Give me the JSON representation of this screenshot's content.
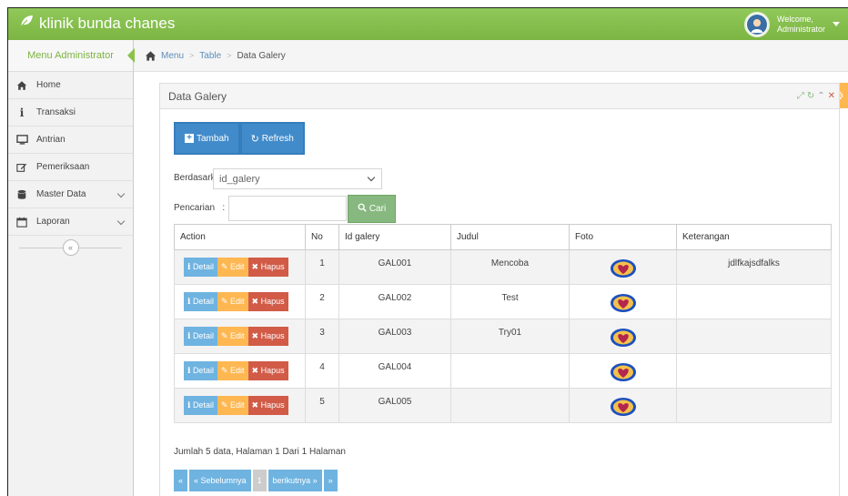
{
  "navbar": {
    "brand": "klinik bunda chanes",
    "welcome": "Welcome,",
    "user": "Administrator"
  },
  "sidebar": {
    "title": "Menu Administrator",
    "items": [
      {
        "label": "Home",
        "icon": "home-icon"
      },
      {
        "label": "Transaksi",
        "icon": "info-icon"
      },
      {
        "label": "Antrian",
        "icon": "desktop-icon"
      },
      {
        "label": "Pemeriksaan",
        "icon": "edit-icon"
      },
      {
        "label": "Master Data",
        "icon": "database-icon"
      },
      {
        "label": "Laporan",
        "icon": "calendar-icon"
      }
    ],
    "collapse_glyph": "«"
  },
  "breadcrumb": {
    "items": [
      "Menu",
      "Table",
      "Data Galery"
    ],
    "separator": ">"
  },
  "panel": {
    "title": "Data Galery",
    "add_label": "Tambah",
    "refresh_label": "Refresh"
  },
  "filter": {
    "by_label": "Berdasarkan:",
    "by_value": "id_galery",
    "search_label": "Pencarian   :",
    "search_value": "",
    "search_button": "Cari"
  },
  "table": {
    "columns": [
      "Action",
      "No",
      "Id galery",
      "Judul",
      "Foto",
      "Keterangan"
    ],
    "action_labels": {
      "detail": "Detail",
      "edit": "Edit",
      "delete": "Hapus"
    },
    "rows": [
      {
        "no": "1",
        "id": "GAL001",
        "judul": "Mencoba",
        "keterangan": "jdlfkajsdfalks"
      },
      {
        "no": "2",
        "id": "GAL002",
        "judul": "Test",
        "keterangan": ""
      },
      {
        "no": "3",
        "id": "GAL003",
        "judul": "Try01",
        "keterangan": ""
      },
      {
        "no": "4",
        "id": "GAL004",
        "judul": "",
        "keterangan": ""
      },
      {
        "no": "5",
        "id": "GAL005",
        "judul": "",
        "keterangan": ""
      }
    ]
  },
  "footer": {
    "info": "Jumlah 5 data, Halaman 1 Dari 1 Halaman",
    "pager": {
      "first": "«",
      "prev": "« Sebelumnya",
      "current": "1",
      "next": "berikutnya »",
      "last": "»"
    }
  },
  "colors": {
    "navbar": "#8bc34a",
    "primary": "#428bca",
    "info": "#6fb3e0",
    "warning": "#ffb752",
    "danger": "#d15b47",
    "success": "#87b87f"
  }
}
